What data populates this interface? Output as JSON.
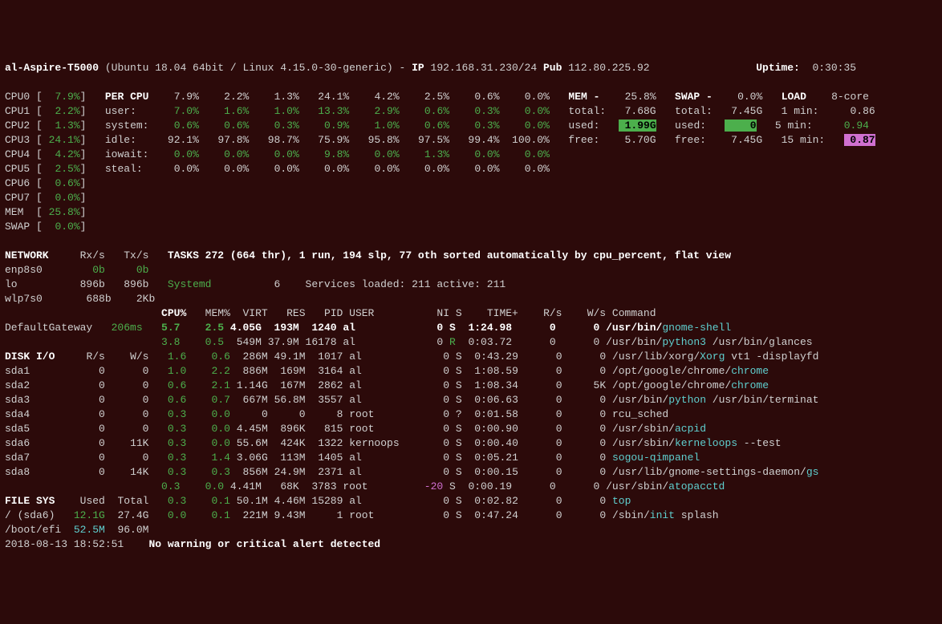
{
  "header": {
    "host": "al-Aspire-T5000",
    "os": "(Ubuntu 18.04 64bit / Linux 4.15.0-30-generic)",
    "ip_label": "IP",
    "ip": "192.168.31.230/24",
    "pub_label": "Pub",
    "pub_ip": "112.80.225.92",
    "uptime_label": "Uptime:",
    "uptime": "0:30:35"
  },
  "cpu": [
    {
      "label": "CPU0",
      "val": "7.9%"
    },
    {
      "label": "CPU1",
      "val": "2.2%"
    },
    {
      "label": "CPU2",
      "val": "1.3%"
    },
    {
      "label": "CPU3",
      "val": "24.1%"
    },
    {
      "label": "CPU4",
      "val": "4.2%"
    },
    {
      "label": "CPU5",
      "val": "2.5%"
    },
    {
      "label": "CPU6",
      "val": "0.6%"
    },
    {
      "label": "CPU7",
      "val": "0.0%"
    }
  ],
  "mem_line": {
    "label": "MEM",
    "val": "25.8%"
  },
  "swap_line": {
    "label": "SWAP",
    "val": "0.0%"
  },
  "percpu": {
    "title": "PER CPU",
    "rows": [
      {
        "label": "user:",
        "v": [
          "7.0%",
          "1.6%",
          "1.0%",
          "13.3%",
          "2.9%",
          "0.6%",
          "0.3%",
          "0.0%"
        ]
      },
      {
        "label": "system:",
        "v": [
          "0.6%",
          "0.6%",
          "0.3%",
          "0.9%",
          "1.0%",
          "0.6%",
          "0.3%",
          "0.0%"
        ]
      },
      {
        "label": "idle:",
        "v": [
          "92.1%",
          "97.8%",
          "98.7%",
          "75.9%",
          "95.8%",
          "97.5%",
          "99.4%",
          "100.0%"
        ]
      },
      {
        "label": "iowait:",
        "v": [
          "0.0%",
          "0.0%",
          "0.0%",
          "9.8%",
          "0.0%",
          "1.3%",
          "0.0%",
          "0.0%"
        ]
      },
      {
        "label": "steal:",
        "v": [
          "0.0%",
          "0.0%",
          "0.0%",
          "0.0%",
          "0.0%",
          "0.0%",
          "0.0%",
          "0.0%"
        ]
      }
    ],
    "head": [
      "7.9%",
      "2.2%",
      "1.3%",
      "24.1%",
      "4.2%",
      "2.5%",
      "0.6%",
      "0.0%"
    ]
  },
  "memblk": {
    "title": "MEM -",
    "pct": "25.8%",
    "total_l": "total:",
    "total": "7.68G",
    "used_l": "used:",
    "used": "1.99G",
    "free_l": "free:",
    "free": "5.70G"
  },
  "swapblk": {
    "title": "SWAP -",
    "pct": "0.0%",
    "total_l": "total:",
    "total": "7.45G",
    "used_l": "used:",
    "used": "0",
    "free_l": "free:",
    "free": "7.45G"
  },
  "load": {
    "title": "LOAD",
    "core": "8-core",
    "m1": "1 min:",
    "v1": "0.86",
    "m5": "5 min:",
    "v5": "0.94",
    "m15": "15 min:",
    "v15": "0.87"
  },
  "net": {
    "title": "NETWORK",
    "rx": "Rx/s",
    "tx": "Tx/s",
    "rows": [
      {
        "if": "enp8s0",
        "rx": "0b",
        "tx": "0b"
      },
      {
        "if": "lo",
        "rx": "896b",
        "tx": "896b"
      },
      {
        "if": "wlp7s0",
        "rx": "688b",
        "tx": "2Kb"
      }
    ]
  },
  "gw": {
    "label": "DefaultGateway",
    "val": "206ms"
  },
  "disk": {
    "title": "DISK I/O",
    "r": "R/s",
    "w": "W/s",
    "rows": [
      {
        "d": "sda1",
        "r": "0",
        "w": "0"
      },
      {
        "d": "sda2",
        "r": "0",
        "w": "0"
      },
      {
        "d": "sda3",
        "r": "0",
        "w": "0"
      },
      {
        "d": "sda4",
        "r": "0",
        "w": "0"
      },
      {
        "d": "sda5",
        "r": "0",
        "w": "0"
      },
      {
        "d": "sda6",
        "r": "0",
        "w": "11K"
      },
      {
        "d": "sda7",
        "r": "0",
        "w": "0"
      },
      {
        "d": "sda8",
        "r": "0",
        "w": "14K"
      }
    ]
  },
  "fs": {
    "title": "FILE SYS",
    "used": "Used",
    "total": "Total",
    "rows": [
      {
        "n": "/ (sda6)",
        "u": "12.1G",
        "t": "27.4G"
      },
      {
        "n": "/boot/efi",
        "u": "52.5M",
        "t": "96.0M"
      }
    ]
  },
  "ts": "2018-08-13 18:52:51",
  "tasks": "TASKS 272 (664 thr), 1 run, 194 slp, 77 oth sorted automatically by cpu_percent, flat view",
  "systemd": {
    "label": "Systemd",
    "n": "6",
    "svc": "Services loaded: 211 active: 211"
  },
  "ph": {
    "cpu": "CPU%",
    "mem": "MEM%",
    "virt": "VIRT",
    "res": "RES",
    "pid": "PID",
    "user": "USER",
    "ni": "NI",
    "s": "S",
    "time": "TIME+",
    "r": "R/s",
    "w": "W/s",
    "cmd": "Command"
  },
  "procs": [
    {
      "cpu": "5.7",
      "mem": "2.5",
      "virt": "4.05G",
      "res": "193M",
      "pid": "1240",
      "user": "al",
      "ni": "0",
      "s": "S",
      "time": "1:24.98",
      "r": "0",
      "w": "0",
      "cmd": "/usr/bin/",
      "hl": "gnome-shell",
      "tail": ""
    },
    {
      "cpu": "3.8",
      "mem": "0.5",
      "virt": "549M",
      "res": "37.9M",
      "pid": "16178",
      "user": "al",
      "ni": "0",
      "s": "R",
      "time": "0:03.72",
      "r": "0",
      "w": "0",
      "cmd": "/usr/bin/",
      "hl": "python3",
      "tail": " /usr/bin/glances"
    },
    {
      "cpu": "1.6",
      "mem": "0.6",
      "virt": "286M",
      "res": "49.1M",
      "pid": "1017",
      "user": "al",
      "ni": "0",
      "s": "S",
      "time": "0:43.29",
      "r": "0",
      "w": "0",
      "cmd": "/usr/lib/xorg/",
      "hl": "Xorg",
      "tail": " vt1 -displayfd"
    },
    {
      "cpu": "1.0",
      "mem": "2.2",
      "virt": "886M",
      "res": "169M",
      "pid": "3164",
      "user": "al",
      "ni": "0",
      "s": "S",
      "time": "1:08.59",
      "r": "0",
      "w": "0",
      "cmd": "/opt/google/chrome/",
      "hl": "chrome",
      "tail": ""
    },
    {
      "cpu": "0.6",
      "mem": "2.1",
      "virt": "1.14G",
      "res": "167M",
      "pid": "2862",
      "user": "al",
      "ni": "0",
      "s": "S",
      "time": "1:08.34",
      "r": "0",
      "w": "5K",
      "cmd": "/opt/google/chrome/",
      "hl": "chrome",
      "tail": ""
    },
    {
      "cpu": "0.6",
      "mem": "0.7",
      "virt": "667M",
      "res": "56.8M",
      "pid": "3557",
      "user": "al",
      "ni": "0",
      "s": "S",
      "time": "0:06.63",
      "r": "0",
      "w": "0",
      "cmd": "/usr/bin/",
      "hl": "python",
      "tail": " /usr/bin/terminat"
    },
    {
      "cpu": "0.3",
      "mem": "0.0",
      "virt": "0",
      "res": "0",
      "pid": "8",
      "user": "root",
      "ni": "0",
      "s": "?",
      "time": "0:01.58",
      "r": "0",
      "w": "0",
      "cmd": "",
      "hl": "",
      "tail": "rcu_sched"
    },
    {
      "cpu": "0.3",
      "mem": "0.0",
      "virt": "4.45M",
      "res": "896K",
      "pid": "815",
      "user": "root",
      "ni": "0",
      "s": "S",
      "time": "0:00.90",
      "r": "0",
      "w": "0",
      "cmd": "/usr/sbin/",
      "hl": "acpid",
      "tail": ""
    },
    {
      "cpu": "0.3",
      "mem": "0.0",
      "virt": "55.6M",
      "res": "424K",
      "pid": "1322",
      "user": "kernoops",
      "ni": "0",
      "s": "S",
      "time": "0:00.40",
      "r": "0",
      "w": "0",
      "cmd": "/usr/sbin/",
      "hl": "kerneloops",
      "tail": " --test"
    },
    {
      "cpu": "0.3",
      "mem": "1.4",
      "virt": "3.06G",
      "res": "113M",
      "pid": "1405",
      "user": "al",
      "ni": "0",
      "s": "S",
      "time": "0:05.21",
      "r": "0",
      "w": "0",
      "cmd": "",
      "hl": "sogou-qimpanel",
      "tail": ""
    },
    {
      "cpu": "0.3",
      "mem": "0.3",
      "virt": "856M",
      "res": "24.9M",
      "pid": "2371",
      "user": "al",
      "ni": "0",
      "s": "S",
      "time": "0:00.15",
      "r": "0",
      "w": "0",
      "cmd": "/usr/lib/gnome-settings-daemon/",
      "hl": "gs",
      "tail": ""
    },
    {
      "cpu": "0.3",
      "mem": "0.0",
      "virt": "4.41M",
      "res": "68K",
      "pid": "3783",
      "user": "root",
      "ni": "-20",
      "s": "S",
      "time": "0:00.19",
      "r": "0",
      "w": "0",
      "cmd": "/usr/sbin/",
      "hl": "atopacctd",
      "tail": ""
    },
    {
      "cpu": "0.3",
      "mem": "0.1",
      "virt": "50.1M",
      "res": "4.46M",
      "pid": "15289",
      "user": "al",
      "ni": "0",
      "s": "S",
      "time": "0:02.82",
      "r": "0",
      "w": "0",
      "cmd": "",
      "hl": "top",
      "tail": ""
    },
    {
      "cpu": "0.0",
      "mem": "0.1",
      "virt": "221M",
      "res": "9.43M",
      "pid": "1",
      "user": "root",
      "ni": "0",
      "s": "S",
      "time": "0:47.24",
      "r": "0",
      "w": "0",
      "cmd": "/sbin/",
      "hl": "init",
      "tail": " splash"
    }
  ],
  "alert": "No warning or critical alert detected"
}
